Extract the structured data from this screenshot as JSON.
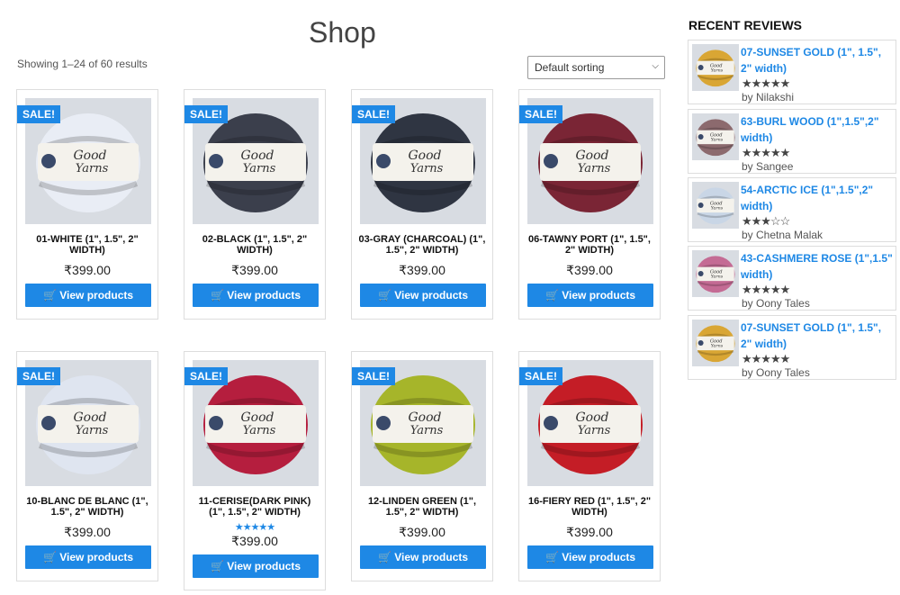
{
  "page": {
    "title": "Shop",
    "result_count": "Showing 1–24 of 60 results",
    "sorting": {
      "selected": "Default sorting"
    }
  },
  "products": [
    {
      "name": "01-WHITE (1\", 1.5\", 2\" WIDTH)",
      "price": "₹399.00",
      "button": "View products",
      "sale": "SALE!",
      "yarn_color": "#e9edf5",
      "rating": null
    },
    {
      "name": "02-BLACK (1\", 1.5\", 2\" WIDTH)",
      "price": "₹399.00",
      "button": "View products",
      "sale": "SALE!",
      "yarn_color": "#3b3f4c",
      "rating": null
    },
    {
      "name": "03-GRAY (CHARCOAL) (1\", 1.5\", 2\" WIDTH)",
      "price": "₹399.00",
      "button": "View products",
      "sale": "SALE!",
      "yarn_color": "#2f3542",
      "rating": null
    },
    {
      "name": "06-TAWNY PORT (1\", 1.5\", 2\" WIDTH)",
      "price": "₹399.00",
      "button": "View products",
      "sale": "SALE!",
      "yarn_color": "#7a2535",
      "rating": null
    },
    {
      "name": "10-BLANC DE BLANC (1\", 1.5\", 2\" WIDTH)",
      "price": "₹399.00",
      "button": "View products",
      "sale": "SALE!",
      "yarn_color": "#dfe5f0",
      "rating": null
    },
    {
      "name": "11-CERISE(DARK PINK) (1\", 1.5\", 2\" WIDTH)",
      "price": "₹399.00",
      "button": "View products",
      "sale": "SALE!",
      "yarn_color": "#b51e3e",
      "rating": 5
    },
    {
      "name": "12-LINDEN GREEN (1\", 1.5\", 2\" WIDTH)",
      "price": "₹399.00",
      "button": "View products",
      "sale": "SALE!",
      "yarn_color": "#a6b52a",
      "rating": null
    },
    {
      "name": "16-FIERY RED (1\", 1.5\", 2\" WIDTH)",
      "price": "₹399.00",
      "button": "View products",
      "sale": "SALE!",
      "yarn_color": "#c41d26",
      "rating": null
    }
  ],
  "sidebar": {
    "title": "RECENT REVIEWS",
    "reviews": [
      {
        "name": "07-SUNSET GOLD (1\", 1.5\", 2\" width)",
        "by": "by Nilakshi",
        "rating": 5,
        "yarn_color": "#d9a634"
      },
      {
        "name": "63-BURL WOOD (1\",1.5\",2\" width)",
        "by": "by Sangee",
        "rating": 5,
        "yarn_color": "#8c6a6e"
      },
      {
        "name": "54-ARCTIC ICE (1\",1.5\",2\" width)",
        "by": "by Chetna Malak",
        "rating": 3,
        "yarn_color": "#c9d6e6"
      },
      {
        "name": "43-CASHMERE ROSE (1\",1.5\" width)",
        "by": "by Oony Tales",
        "rating": 5,
        "yarn_color": "#c46b94"
      },
      {
        "name": "07-SUNSET GOLD (1\", 1.5\", 2\" width)",
        "by": "by Oony Tales",
        "rating": 5,
        "yarn_color": "#d9a634"
      }
    ]
  },
  "colors": {
    "accent": "#1e88e5"
  }
}
